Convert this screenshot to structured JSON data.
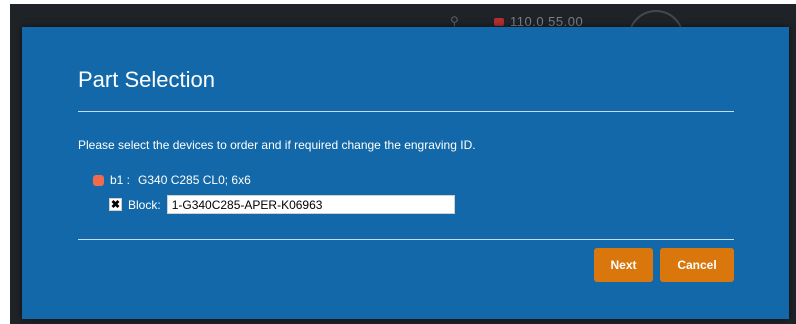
{
  "background": {
    "status_text": "110.0  55.00"
  },
  "dialog": {
    "title": "Part Selection",
    "instruction": "Please select the devices to order and if required change the engraving ID.",
    "device": {
      "id_label": "b1 :",
      "description": "G340 C285 CL0; 6x6",
      "status_color": "#f06a4f"
    },
    "block": {
      "checked": true,
      "checkbox_mark": "✖",
      "label": "Block:",
      "value": "1-G340C285-APER-K06963"
    },
    "buttons": {
      "next_label": "Next",
      "cancel_label": "Cancel"
    }
  },
  "colors": {
    "dialog_bg": "#1268a8",
    "button_bg": "#d9770c",
    "app_bg": "#1f2328"
  }
}
